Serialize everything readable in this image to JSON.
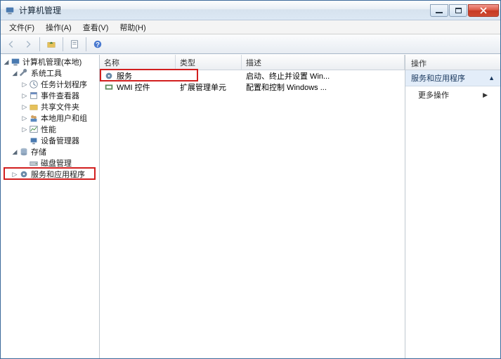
{
  "window": {
    "title": "计算机管理"
  },
  "menu": {
    "file": "文件(F)",
    "action": "操作(A)",
    "view": "查看(V)",
    "help": "帮助(H)"
  },
  "tree": {
    "root": "计算机管理(本地)",
    "sys_tools": "系统工具",
    "task_scheduler": "任务计划程序",
    "event_viewer": "事件查看器",
    "shared_folders": "共享文件夹",
    "local_users": "本地用户和组",
    "performance": "性能",
    "device_manager": "设备管理器",
    "storage": "存储",
    "disk_management": "磁盘管理",
    "services_apps": "服务和应用程序"
  },
  "list": {
    "cols": {
      "name": "名称",
      "type": "类型",
      "desc": "描述"
    },
    "rows": [
      {
        "name": "服务",
        "type": "",
        "desc": "启动、终止并设置 Win..."
      },
      {
        "name": "WMI 控件",
        "type": "扩展管理单元",
        "desc": "配置和控制 Windows ..."
      }
    ]
  },
  "actions": {
    "header": "操作",
    "category": "服务和应用程序",
    "more": "更多操作"
  }
}
